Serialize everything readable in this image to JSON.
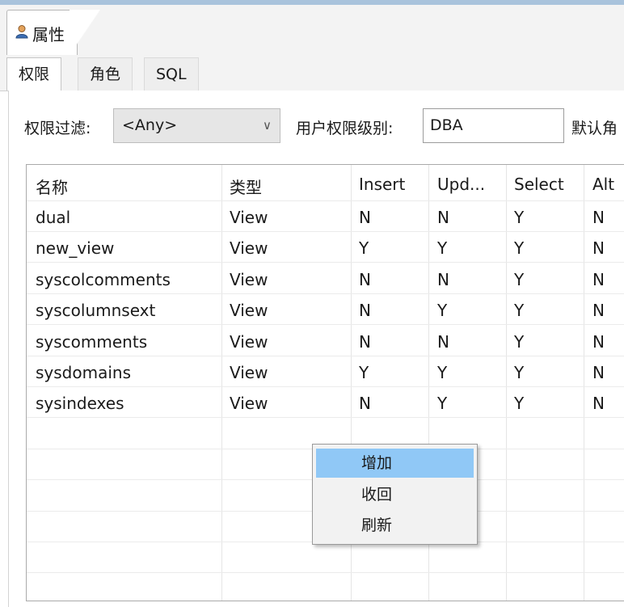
{
  "view": {
    "title": "属性",
    "icon": "user-icon"
  },
  "tabs": [
    {
      "label": "权限",
      "active": true
    },
    {
      "label": "角色",
      "active": false
    },
    {
      "label": "SQL",
      "active": false
    }
  ],
  "filters": {
    "privilege_filter_label": "权限过滤:",
    "privilege_filter_value": "<Any>",
    "user_level_label": "用户权限级别:",
    "user_level_value": "DBA",
    "default_label": "默认角"
  },
  "table": {
    "columns": [
      "名称",
      "类型",
      "Insert",
      "Upd...",
      "Select",
      "Alt"
    ],
    "rows": [
      [
        "dual",
        "View",
        "N",
        "N",
        "Y",
        "N"
      ],
      [
        "new_view",
        "View",
        "Y",
        "Y",
        "Y",
        "N"
      ],
      [
        "syscolcomments",
        "View",
        "N",
        "N",
        "Y",
        "N"
      ],
      [
        "syscolumnsext",
        "View",
        "N",
        "Y",
        "Y",
        "N"
      ],
      [
        "syscomments",
        "View",
        "N",
        "N",
        "Y",
        "N"
      ],
      [
        "sysdomains",
        "View",
        "Y",
        "Y",
        "Y",
        "N"
      ],
      [
        "sysindexes",
        "View",
        "N",
        "Y",
        "Y",
        "N"
      ]
    ]
  },
  "context_menu": {
    "items": [
      "增加",
      "收回",
      "刷新"
    ],
    "highlighted": "增加"
  }
}
